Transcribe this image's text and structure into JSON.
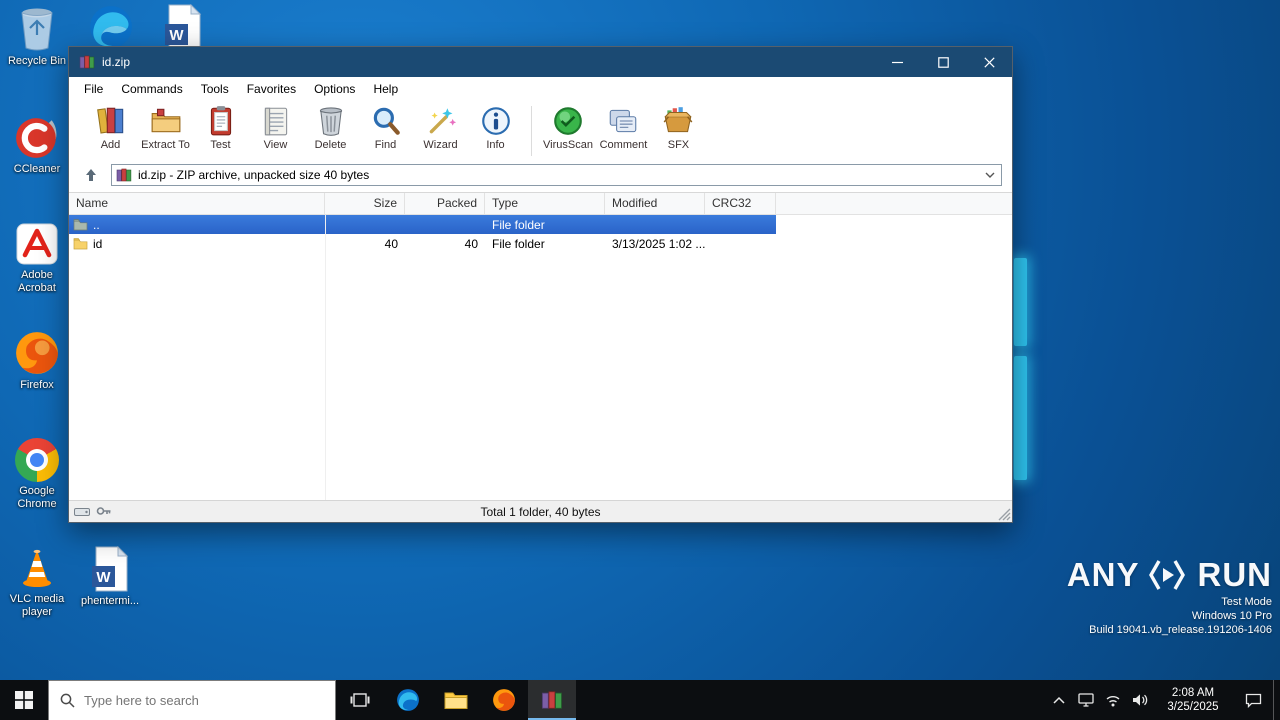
{
  "desktop": {
    "icons": {
      "recycle_bin": "Recycle Bin",
      "ccleaner": "CCleaner",
      "acrobat": "Adobe Acrobat",
      "firefox": "Firefox",
      "chrome": "Google Chrome",
      "vlc": "VLC media player",
      "word_doc": "phentermi..."
    },
    "watermark": {
      "brand_left": "ANY",
      "brand_right": "RUN",
      "line1": "Test Mode",
      "line2": "Windows 10 Pro",
      "line3": "Build 19041.vb_release.191206-1406"
    }
  },
  "winrar": {
    "title": "id.zip",
    "menu": [
      "File",
      "Commands",
      "Tools",
      "Favorites",
      "Options",
      "Help"
    ],
    "toolbar": [
      "Add",
      "Extract To",
      "Test",
      "View",
      "Delete",
      "Find",
      "Wizard",
      "Info",
      "VirusScan",
      "Comment",
      "SFX"
    ],
    "address": "id.zip - ZIP archive, unpacked size 40 bytes",
    "columns": [
      "Name",
      "Size",
      "Packed",
      "Type",
      "Modified",
      "CRC32"
    ],
    "rows": [
      {
        "name": "..",
        "size": "",
        "packed": "",
        "type": "File folder",
        "modified": "",
        "crc32": ""
      },
      {
        "name": "id",
        "size": "40",
        "packed": "40",
        "type": "File folder",
        "modified": "3/13/2025 1:02 ...",
        "crc32": ""
      }
    ],
    "status": "Total 1 folder, 40 bytes"
  },
  "taskbar": {
    "search_placeholder": "Type here to search",
    "time": "2:08 AM",
    "date": "3/25/2025"
  }
}
